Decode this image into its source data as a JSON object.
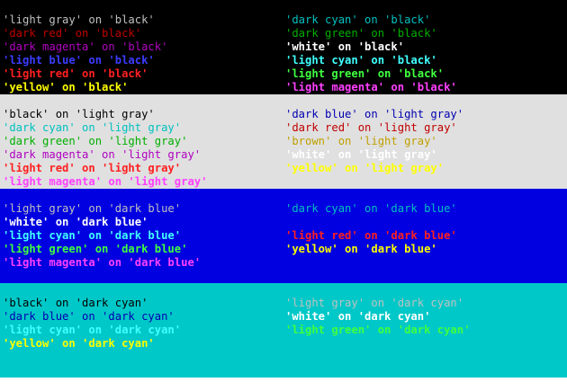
{
  "panels": [
    {
      "bg": "#000000",
      "left": [
        {
          "text": "'light gray' on 'black'",
          "color": "#c0c0c0",
          "bold": false
        },
        {
          "text": "'dark red' on 'black'",
          "color": "#c00000",
          "bold": false
        },
        {
          "text": "'dark magenta' on 'black'",
          "color": "#b000c0",
          "bold": false
        },
        {
          "text": "'light blue' on 'black'",
          "color": "#3c3cff",
          "bold": true
        },
        {
          "text": "'light red' on 'black'",
          "color": "#ff2020",
          "bold": true
        },
        {
          "text": "'yellow' on 'black'",
          "color": "#ffff00",
          "bold": true
        }
      ],
      "right": [
        {
          "text": "'dark cyan' on 'black'",
          "color": "#00c0c0",
          "bold": false
        },
        {
          "text": "'dark green' on 'black'",
          "color": "#00b000",
          "bold": false
        },
        {
          "text": "'white' on 'black'",
          "color": "#ffffff",
          "bold": true
        },
        {
          "text": "'light cyan' on 'black'",
          "color": "#40ffff",
          "bold": true
        },
        {
          "text": "'light green' on 'black'",
          "color": "#40ff40",
          "bold": true
        },
        {
          "text": "'light magenta' on 'black'",
          "color": "#ff40ff",
          "bold": true
        }
      ]
    },
    {
      "bg": "#e0e0e0",
      "left": [
        {
          "text": "'black' on 'light gray'",
          "color": "#000000",
          "bold": false
        },
        {
          "text": "'dark cyan' on 'light gray'",
          "color": "#00c0c0",
          "bold": false
        },
        {
          "text": "'dark green' on 'light gray'",
          "color": "#00b000",
          "bold": false
        },
        {
          "text": "'dark magenta' on 'light gray'",
          "color": "#b000c0",
          "bold": false
        },
        {
          "text": "'light red' on 'light gray'",
          "color": "#ff2020",
          "bold": true
        },
        {
          "text": "'light magenta' on 'light gray'",
          "color": "#ff40ff",
          "bold": true
        }
      ],
      "right": [
        {
          "text": "'dark blue' on 'light gray'",
          "color": "#0000b0",
          "bold": false
        },
        {
          "text": "'dark red' on 'light gray'",
          "color": "#c00000",
          "bold": false
        },
        {
          "text": "'brown' on 'light gray'",
          "color": "#c0a000",
          "bold": false
        },
        {
          "text": "'white' on 'light gray'",
          "color": "#ffffff",
          "bold": true
        },
        {
          "text": "'yellow' on 'light gray'",
          "color": "#ffff00",
          "bold": true
        }
      ]
    },
    {
      "bg": "#0000e0",
      "left": [
        {
          "text": "'light gray' on 'dark blue'",
          "color": "#c0c0c0",
          "bold": false
        },
        {
          "text": "'white' on 'dark blue'",
          "color": "#ffffff",
          "bold": true
        },
        {
          "text": "'light cyan' on 'dark blue'",
          "color": "#40ffff",
          "bold": true
        },
        {
          "text": "'light green' on 'dark blue'",
          "color": "#40ff40",
          "bold": true
        },
        {
          "text": "'light magenta' on 'dark blue'",
          "color": "#ff40ff",
          "bold": true
        }
      ],
      "right": [
        {
          "text": "'dark cyan' on 'dark blue'",
          "color": "#00c0c0",
          "bold": false
        },
        {
          "text": "",
          "color": "#000000",
          "bold": false
        },
        {
          "text": "'light red' on 'dark blue'",
          "color": "#ff2020",
          "bold": true
        },
        {
          "text": "'yellow' on 'dark blue'",
          "color": "#ffff00",
          "bold": true
        }
      ]
    },
    {
      "bg": "#00c8c8",
      "left": [
        {
          "text": "'black' on 'dark cyan'",
          "color": "#000000",
          "bold": false
        },
        {
          "text": "'dark blue' on 'dark cyan'",
          "color": "#0000b0",
          "bold": false
        },
        {
          "text": "'light cyan' on 'dark cyan'",
          "color": "#40ffff",
          "bold": true
        },
        {
          "text": "'yellow' on 'dark cyan'",
          "color": "#ffff00",
          "bold": true
        }
      ],
      "right": [
        {
          "text": "'light gray' on 'dark cyan'",
          "color": "#c0c0c0",
          "bold": false
        },
        {
          "text": "'white' on 'dark cyan'",
          "color": "#ffffff",
          "bold": true
        },
        {
          "text": "'light green' on 'dark cyan'",
          "color": "#40ff40",
          "bold": true
        }
      ]
    }
  ]
}
